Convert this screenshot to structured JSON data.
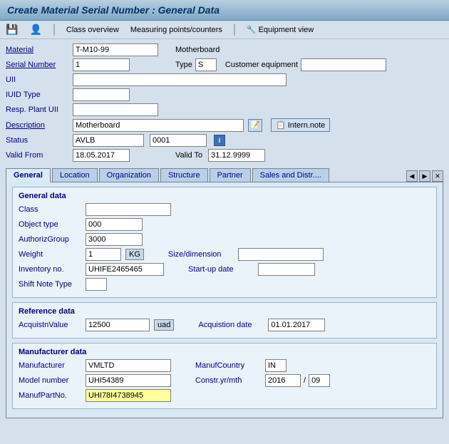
{
  "title": "Create Material Serial Number : General Data",
  "toolbar": {
    "save_icon": "💾",
    "person_icon": "👤",
    "class_overview": "Class overview",
    "measuring_points": "Measuring points/counters",
    "wrench_icon": "🔧",
    "equipment_view": "Equipment view"
  },
  "header": {
    "material_label": "Material",
    "material_value": "T-M10-99",
    "right_label": "Motherboard",
    "serial_number_label": "Serial Number",
    "serial_number_value": "1",
    "type_label": "Type",
    "type_value": "S",
    "customer_equipment_label": "Customer equipment",
    "uii_label": "UII",
    "uii_value": "",
    "iuid_type_label": "IUID Type",
    "iuid_type_value": "",
    "resp_plant_uii_label": "Resp. Plant UII",
    "resp_plant_uii_value": "",
    "description_label": "Description",
    "description_value": "Motherboard",
    "status_label": "Status",
    "status_value": "AVLB",
    "status_code": "0001",
    "valid_from_label": "Valid From",
    "valid_from_value": "18.05.2017",
    "valid_to_label": "Valid To",
    "valid_to_value": "31.12.9999",
    "intern_note_label": "Intern.note"
  },
  "tabs": [
    {
      "label": "General",
      "active": true
    },
    {
      "label": "Location",
      "active": false
    },
    {
      "label": "Organization",
      "active": false
    },
    {
      "label": "Structure",
      "active": false
    },
    {
      "label": "Partner",
      "active": false
    },
    {
      "label": "Sales and Distr....",
      "active": false
    }
  ],
  "general_data": {
    "section_title": "General data",
    "class_label": "Class",
    "class_value": "",
    "object_type_label": "Object type",
    "object_type_value": "000",
    "authoriz_group_label": "AuthorizGroup",
    "authoriz_group_value": "3000",
    "weight_label": "Weight",
    "weight_value": "1",
    "weight_unit": "KG",
    "size_dimension_label": "Size/dimension",
    "size_dimension_value": "",
    "inventory_label": "Inventory no.",
    "inventory_value": "UHIFE2465465",
    "startup_date_label": "Start-up date",
    "startup_date_value": "",
    "shift_note_label": "Shift Note Type",
    "shift_note_value": ""
  },
  "reference_data": {
    "section_title": "Reference data",
    "acquistn_label": "AcquistnValue",
    "acquistn_value": "12500",
    "acquistn_unit": "uad",
    "acquistion_date_label": "Acquistion date",
    "acquistion_date_value": "01.01.2017"
  },
  "manufacturer_data": {
    "section_title": "Manufacturer data",
    "manufacturer_label": "Manufacturer",
    "manufacturer_value": "VMLTD",
    "manuf_country_label": "ManufCountry",
    "manuf_country_value": "IN",
    "model_number_label": "Model number",
    "model_number_value": "UHI54389",
    "constr_yr_label": "Constr.yr/mth",
    "constr_yr_value": "2016",
    "constr_mth_value": "09",
    "manuf_part_label": "ManufPartNo.",
    "manuf_part_value": "UHI78I4738945"
  }
}
